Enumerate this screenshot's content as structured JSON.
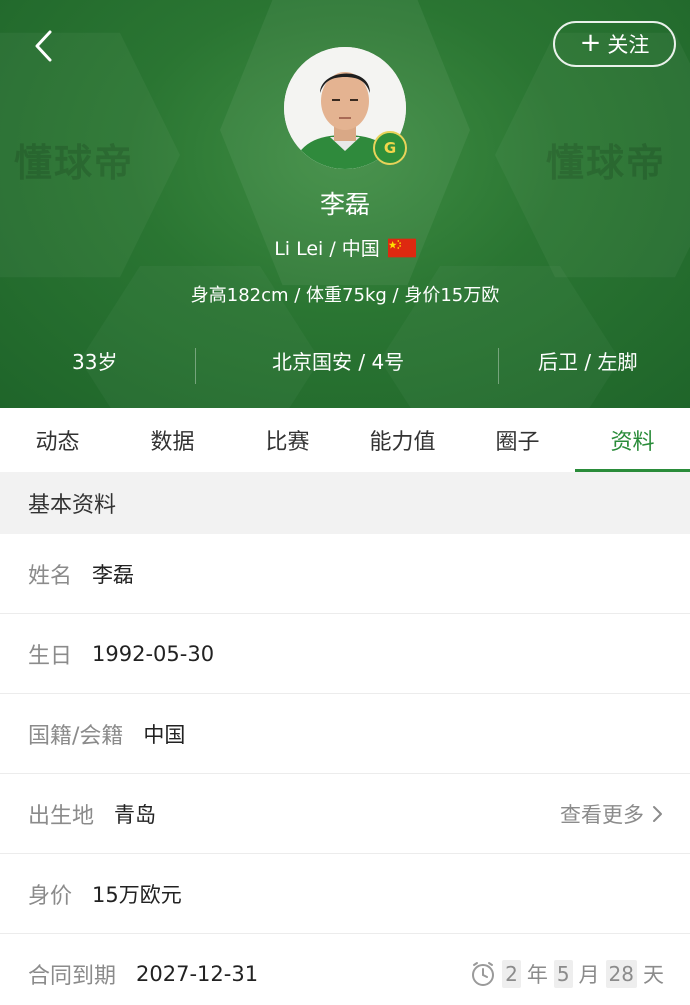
{
  "header": {
    "watermark_text": "懂球帝",
    "follow_label": "关注",
    "player_name": "李磊",
    "name_nationality": "Li Lei / 中国",
    "physical": "身高182cm / 体重75kg / 身价15万欧",
    "stats": {
      "age": "33岁",
      "club_number": "北京国安 / 4号",
      "position_foot": "后卫 / 左脚"
    },
    "club_badge_text": "G",
    "colors": {
      "header_green": "#2a7532",
      "accent_green": "#2a8c3a"
    }
  },
  "tabs": [
    {
      "label": "动态"
    },
    {
      "label": "数据"
    },
    {
      "label": "比赛"
    },
    {
      "label": "能力值"
    },
    {
      "label": "圈子"
    },
    {
      "label": "资料"
    }
  ],
  "active_tab": "资料",
  "basic_info": {
    "title": "基本资料",
    "rows": {
      "name": {
        "label": "姓名",
        "value": "李磊"
      },
      "birthday": {
        "label": "生日",
        "value": "1992-05-30"
      },
      "nationality": {
        "label": "国籍/会籍",
        "value": "中国"
      },
      "birthplace": {
        "label": "出生地",
        "value": "青岛",
        "more": "查看更多"
      },
      "market_value": {
        "label": "身价",
        "value": "15万欧元"
      },
      "contract": {
        "label": "合同到期",
        "value": "2027-12-31",
        "countdown": {
          "years": "2",
          "year_unit": "年",
          "months": "5",
          "month_unit": "月",
          "days": "28",
          "day_unit": "天"
        }
      }
    }
  },
  "icons": [
    "back-arrow-icon",
    "plus-icon",
    "china-flag-icon",
    "club-badge-icon",
    "chevron-right-icon",
    "clock-icon"
  ]
}
